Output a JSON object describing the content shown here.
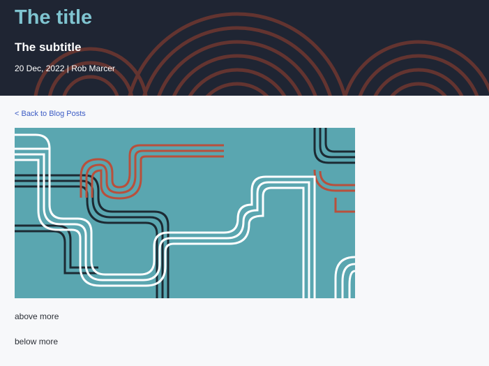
{
  "header": {
    "title": "The title",
    "subtitle": "The subtitle",
    "date": "20 Dec, 2022",
    "separator": "|",
    "author": "Rob Marcer"
  },
  "nav": {
    "back_label": "< Back to Blog Posts"
  },
  "article": {
    "hero_image_icon": "abstract-pipes-artwork",
    "paragraphs": [
      "above more",
      "below more"
    ]
  },
  "colors": {
    "header_bg": "#1f2533",
    "title": "#7fc4d0",
    "link": "#3b5bc4",
    "image_bg": "#5aa6b0",
    "pipe_red": "#b8503c",
    "pipe_dark": "#1c2a33",
    "pipe_white": "#ffffff"
  }
}
